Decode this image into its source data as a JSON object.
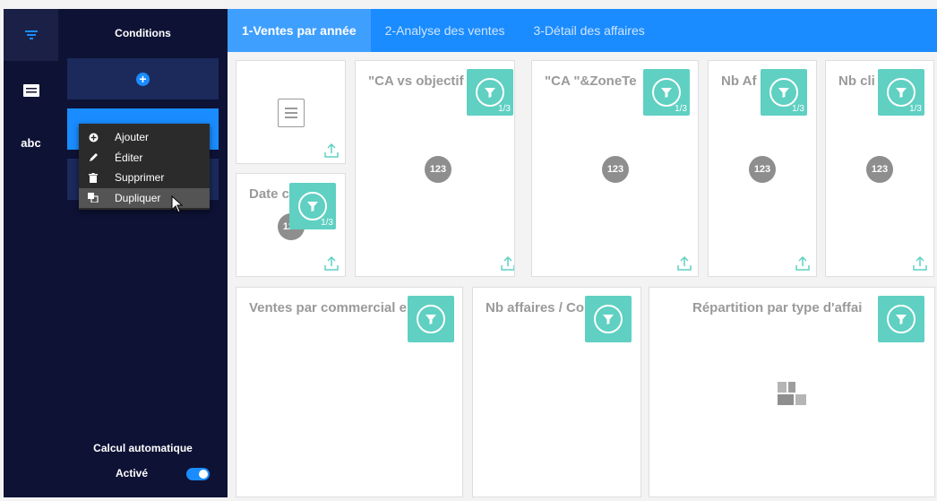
{
  "rail": {
    "items": [
      {
        "icon": "filter-lines-icon",
        "active": true
      },
      {
        "icon": "text-block-icon",
        "active": false
      },
      {
        "icon": "abc-icon",
        "label": "abc",
        "active": false
      }
    ]
  },
  "panel": {
    "title": "Conditions",
    "auto_calc_label": "Calcul automatique",
    "active_label": "Activé",
    "toggle_on": true
  },
  "context_menu": {
    "items": [
      {
        "label": "Ajouter",
        "icon": "plus-circle-icon"
      },
      {
        "label": "Éditer",
        "icon": "pencil-icon"
      },
      {
        "label": "Supprimer",
        "icon": "trash-icon"
      },
      {
        "label": "Dupliquer",
        "icon": "duplicate-icon"
      }
    ],
    "hovered": "Dupliquer"
  },
  "tabs": [
    {
      "label": "1-Ventes par année",
      "active": true
    },
    {
      "label": "2-Analyse des ventes",
      "active": false
    },
    {
      "label": "3-Détail des affaires",
      "active": false
    }
  ],
  "cards": {
    "ca_vs_objectif": {
      "title": "\"CA vs objectif",
      "filter_count": "1/3",
      "icon_text": "123"
    },
    "ca_zone": {
      "title": "\"CA \"&ZoneTe",
      "filter_count": "1/3",
      "icon_text": "123"
    },
    "nb_affaires_top": {
      "title": "Nb Af",
      "filter_count": "1/3",
      "icon_text": "123"
    },
    "nb_clients": {
      "title": "Nb cli",
      "filter_count": "1/3",
      "icon_text": "123"
    },
    "date": {
      "title": "Date c",
      "filter_count": "1/3",
      "icon_text": "123"
    },
    "ventes_commercial": {
      "title": "Ventes par commercial e"
    },
    "nb_affaires_bottom": {
      "title": "Nb affaires / Co"
    },
    "repartition": {
      "title": "Répartition par type d'affai"
    }
  },
  "colors": {
    "sidebar_bg": "#0e1235",
    "accent": "#1a8cff",
    "filter_badge": "#5fd0c2",
    "tab_bar": "#1a8cff"
  }
}
